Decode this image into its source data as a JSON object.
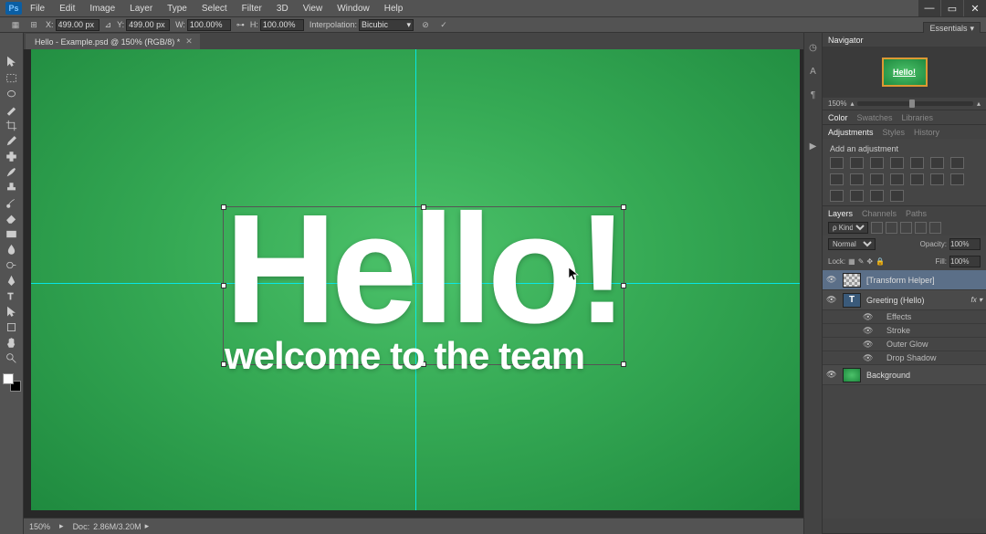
{
  "menu": {
    "items": [
      "File",
      "Edit",
      "Image",
      "Layer",
      "Type",
      "Select",
      "Filter",
      "3D",
      "View",
      "Window",
      "Help"
    ],
    "ps": "Ps"
  },
  "workspace": "Essentials",
  "options": {
    "x": "499.00 px",
    "y": "499.00 px",
    "w": "100.00%",
    "h": "100.00%",
    "interp_label": "Interpolation:",
    "interp": "Bicubic"
  },
  "document": {
    "tab": "Hello - Example.psd @ 150% (RGB/8) *"
  },
  "canvas": {
    "headline": "Hello!",
    "subline": "welcome to the team"
  },
  "navigator": {
    "tab": "Navigator",
    "thumb": "Hello!",
    "zoom": "150%"
  },
  "color_panel": {
    "tabs": [
      "Color",
      "Swatches",
      "Libraries"
    ]
  },
  "adjust": {
    "tabs": [
      "Adjustments",
      "Styles",
      "History"
    ],
    "title": "Add an adjustment"
  },
  "layers": {
    "tabs": [
      "Layers",
      "Channels",
      "Paths"
    ],
    "kind": "ρ Kind",
    "blend": "Normal",
    "opacity_label": "Opacity:",
    "opacity": "100%",
    "lock_label": "Lock:",
    "fill_label": "Fill:",
    "fill": "100%",
    "items": [
      {
        "name": "[Transform Helper]",
        "type": "check",
        "sel": true
      },
      {
        "name": "Greeting (Hello)",
        "type": "T",
        "fx": true
      },
      {
        "name": "Background",
        "type": "g"
      }
    ],
    "effects": [
      "Effects",
      "Stroke",
      "Outer Glow",
      "Drop Shadow"
    ]
  },
  "status": {
    "zoom": "150%",
    "doc_label": "Doc:",
    "doc": "2.86M/3.20M"
  }
}
